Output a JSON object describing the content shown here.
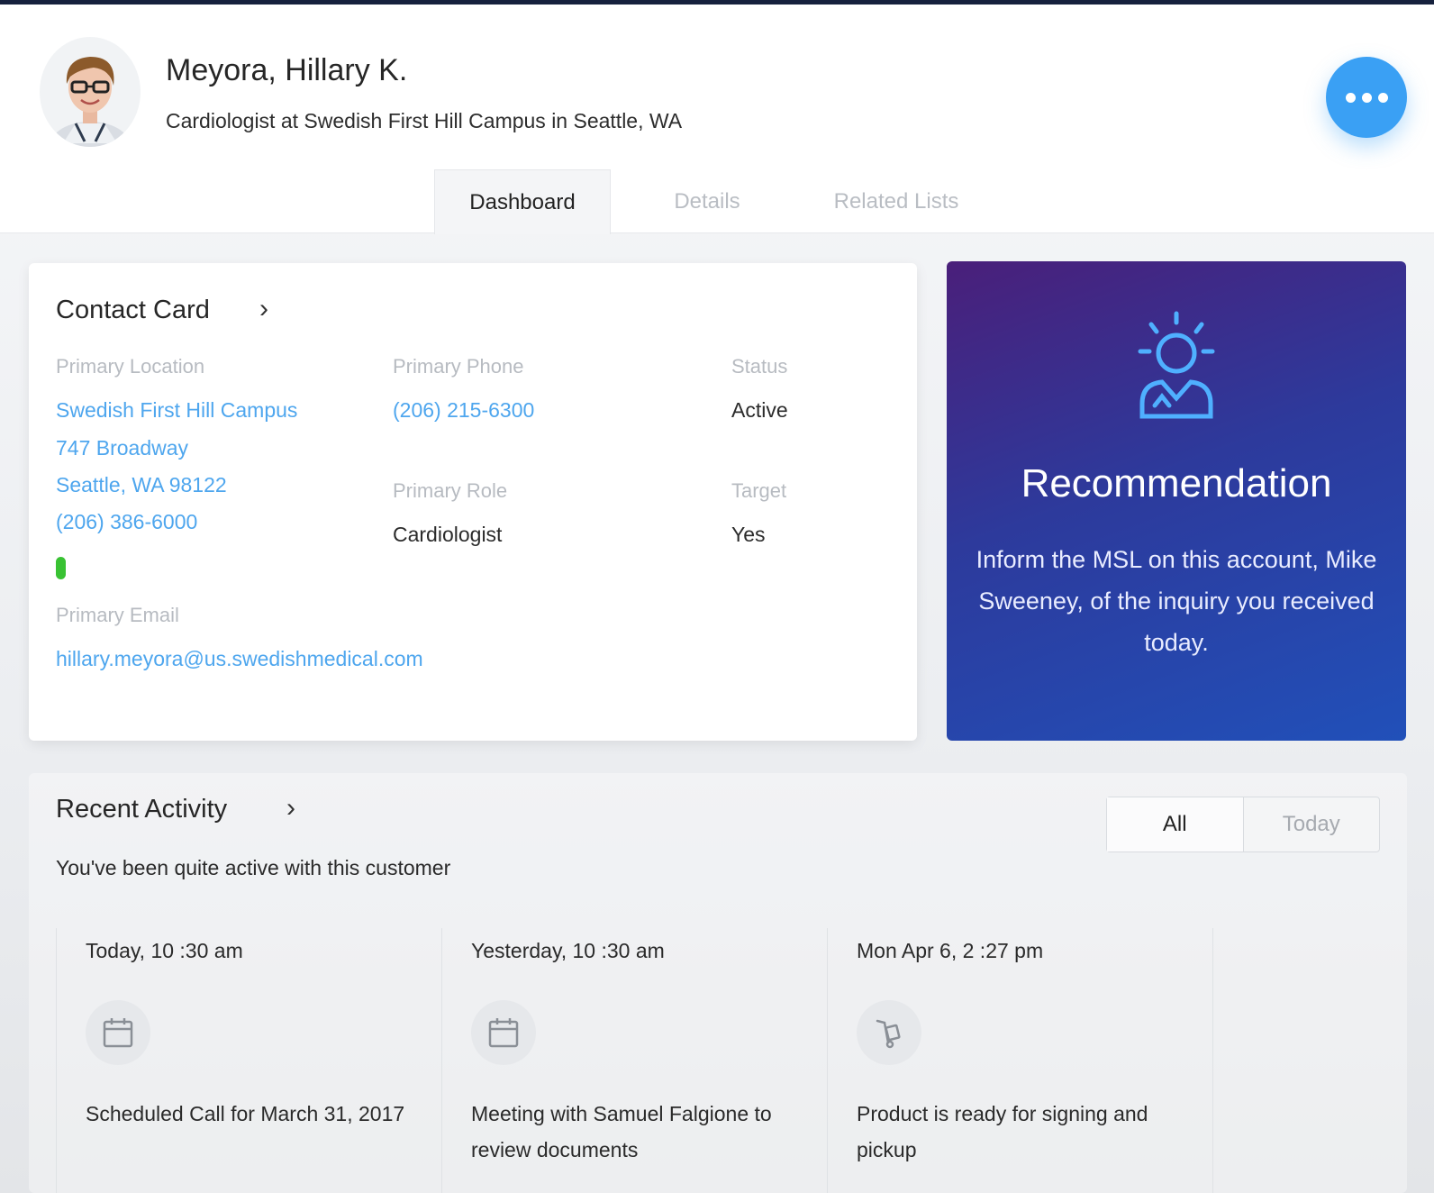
{
  "header": {
    "name": "Meyora, Hillary K.",
    "subtitle": "Cardiologist at Swedish First Hill Campus in Seattle, WA",
    "more_icon": "more-horizontal-icon"
  },
  "tabs": [
    {
      "label": "Dashboard",
      "active": true
    },
    {
      "label": "Details",
      "active": false
    },
    {
      "label": "Related Lists",
      "active": false
    }
  ],
  "contact_card": {
    "title": "Contact Card",
    "primary_location": {
      "label": "Primary Location",
      "lines": [
        "Swedish First Hill Campus",
        "747 Broadway",
        "Seattle, WA 98122",
        "(206) 386-6000"
      ]
    },
    "primary_phone": {
      "label": "Primary Phone",
      "value": "(206) 215-6300"
    },
    "status": {
      "label": "Status",
      "value": "Active"
    },
    "primary_role": {
      "label": "Primary Role",
      "value": "Cardiologist"
    },
    "target": {
      "label": "Target",
      "value": "Yes"
    },
    "primary_email": {
      "label": "Primary Email",
      "value": "hillary.meyora@us.swedishmedical.com"
    }
  },
  "recommendation": {
    "title": "Recommendation",
    "text": "Inform the MSL on this account, Mike Sweeney, of the inquiry you received today.",
    "icon": "lightbulb-person-icon"
  },
  "recent_activity": {
    "title": "Recent Activity",
    "subtitle": "You've been quite active with this customer",
    "filters": [
      "All",
      "Today"
    ],
    "items": [
      {
        "time": "Today, 10 :30 am",
        "icon": "calendar-icon",
        "text": "Scheduled Call for March 31, 2017"
      },
      {
        "time": "Yesterday, 10 :30 am",
        "icon": "calendar-icon",
        "text": "Meeting with Samuel Falgione to review documents"
      },
      {
        "time": "Mon Apr 6, 2 :27 pm",
        "icon": "hand-truck-icon",
        "text": "Product is ready for signing and pickup"
      }
    ]
  },
  "colors": {
    "accent": "#3aa0f4",
    "link": "#4ea6ee",
    "status_green": "#39c233",
    "reco_gradient_start": "#4a1f7a",
    "reco_gradient_end": "#2150b9"
  }
}
